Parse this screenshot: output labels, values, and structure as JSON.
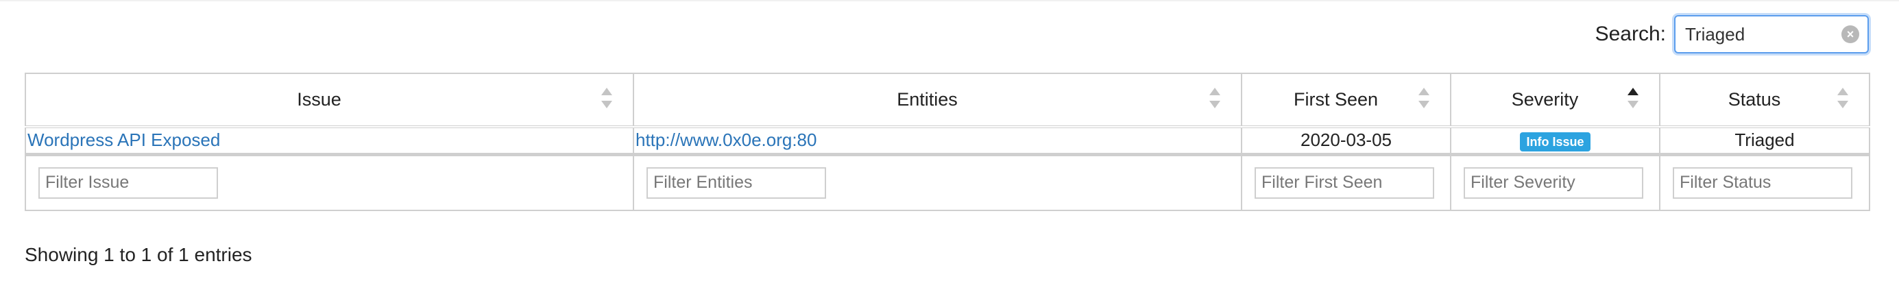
{
  "search": {
    "label": "Search:",
    "value": "Triaged"
  },
  "table": {
    "columns": [
      {
        "label": "Issue",
        "sort": "none"
      },
      {
        "label": "Entities",
        "sort": "none"
      },
      {
        "label": "First Seen",
        "sort": "none"
      },
      {
        "label": "Severity",
        "sort": "ascending"
      },
      {
        "label": "Status",
        "sort": "none"
      }
    ],
    "rows": [
      {
        "issue": "Wordpress API Exposed",
        "entity": "http://www.0x0e.org:80",
        "first_seen": "2020-03-05",
        "severity": "Info Issue",
        "status": "Triaged"
      }
    ],
    "filters": {
      "issue": "Filter Issue",
      "entities": "Filter Entities",
      "first_seen": "Filter First Seen",
      "severity": "Filter Severity",
      "status": "Filter Status"
    }
  },
  "info": "Showing 1 to 1 of 1 entries",
  "colors": {
    "link": "#2a74b8",
    "badge": "#2ca3e0",
    "focus": "#5b9ded",
    "border": "#cfcfcf"
  }
}
